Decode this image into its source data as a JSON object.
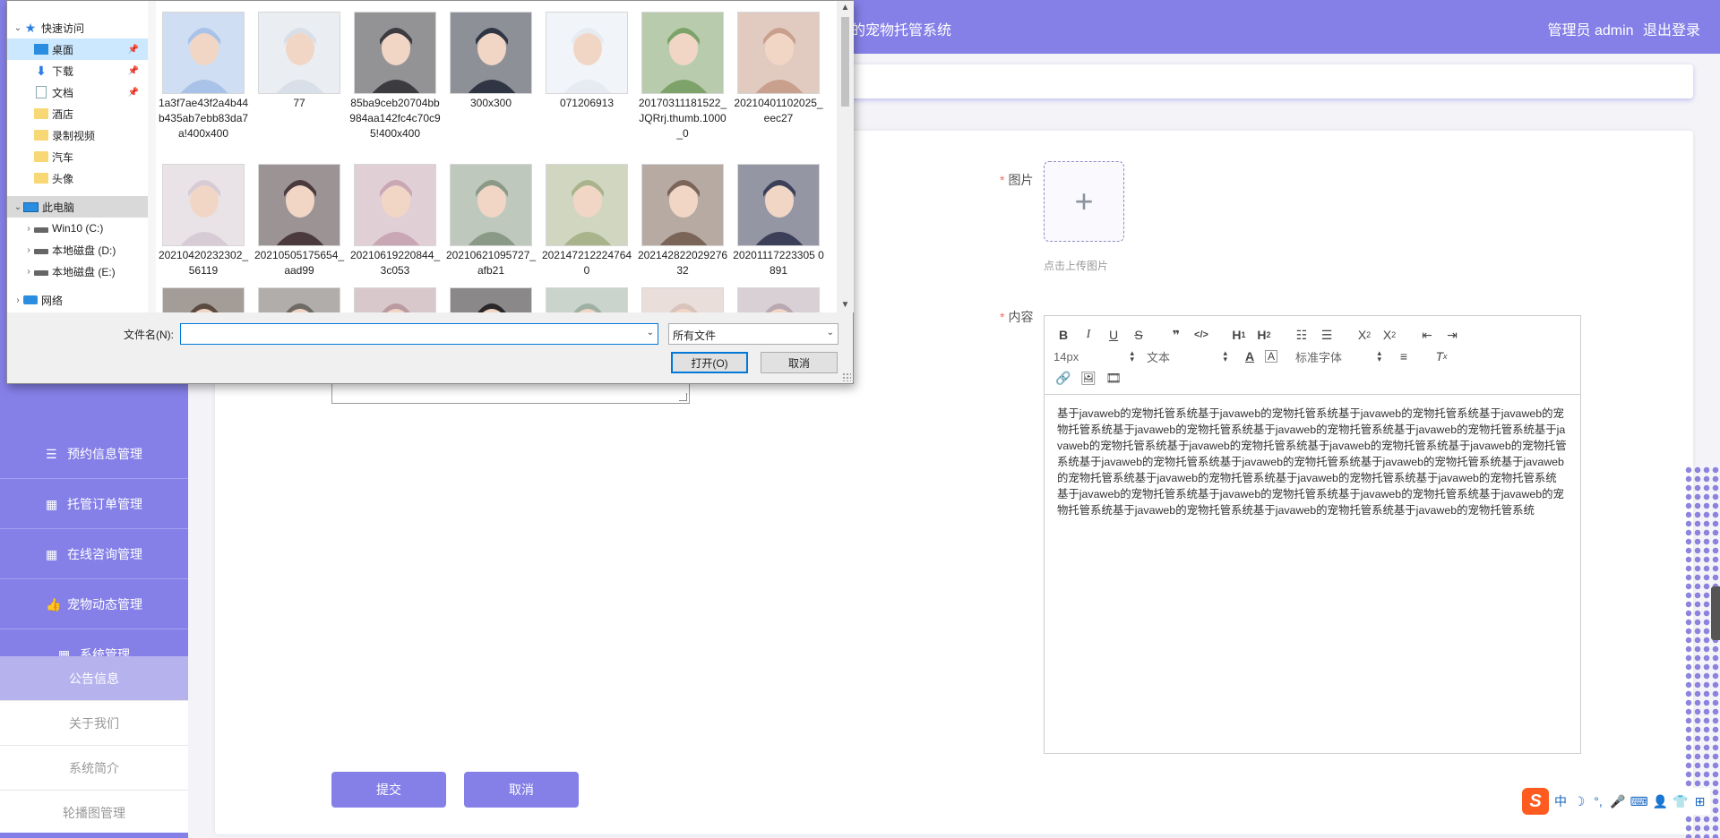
{
  "header": {
    "title_fragment": "的宠物托管系统",
    "user_text": "管理员 admin",
    "logout_label": "退出登录"
  },
  "sidebar": {
    "menu": [
      {
        "label": "预约信息管理",
        "icon": "list-icon"
      },
      {
        "label": "托管订单管理",
        "icon": "grid-icon"
      },
      {
        "label": "在线咨询管理",
        "icon": "grid-icon"
      },
      {
        "label": "宠物动态管理",
        "icon": "thumbs-up-icon"
      },
      {
        "label": "系统管理",
        "icon": "grid-icon"
      }
    ],
    "submenu": [
      {
        "label": "公告信息",
        "active": true
      },
      {
        "label": "关于我们",
        "active": false
      },
      {
        "label": "系统简介",
        "active": false
      },
      {
        "label": "轮播图管理",
        "active": false
      }
    ]
  },
  "form": {
    "image_label": "图片",
    "upload_tip": "点击上传图片",
    "content_label": "内容",
    "submit_label": "提交",
    "cancel_label": "取消"
  },
  "editor": {
    "font_size": "14px",
    "text_type": "文本",
    "font_family": "标准字体",
    "toolbar_row1": [
      "B",
      "I",
      "U",
      "S",
      "❞",
      "</>",
      "H1",
      "H2",
      "list-ordered",
      "list-bullet",
      "X₂",
      "X²",
      "outdent",
      "indent"
    ],
    "content": "基于javaweb的宠物托管系统基于javaweb的宠物托管系统基于javaweb的宠物托管系统基于javaweb的宠物托管系统基于javaweb的宠物托管系统基于javaweb的宠物托管系统基于javaweb的宠物托管系统基于javaweb的宠物托管系统基于javaweb的宠物托管系统基于javaweb的宠物托管系统基于javaweb的宠物托管系统基于javaweb的宠物托管系统基于javaweb的宠物托管系统基于javaweb的宠物托管系统基于javaweb的宠物托管系统基于javaweb的宠物托管系统基于javaweb的宠物托管系统基于javaweb的宠物托管系统基于javaweb的宠物托管系统基于javaweb的宠物托管系统基于javaweb的宠物托管系统基于javaweb的宠物托管系统基于javaweb的宠物托管系统基于javaweb的宠物托管系统基于javaweb的宠物托管系统"
  },
  "dialog": {
    "nav": [
      {
        "label": "快速访问",
        "icon": "star-icon",
        "chevron": "⌄",
        "indent": 0
      },
      {
        "label": "桌面",
        "icon": "desktop-icon",
        "pinned": true,
        "selected": true,
        "indent": 1
      },
      {
        "label": "下载",
        "icon": "download-icon",
        "pinned": true,
        "indent": 1
      },
      {
        "label": "文档",
        "icon": "document-icon",
        "pinned": true,
        "indent": 1
      },
      {
        "label": "酒店",
        "icon": "folder-icon",
        "indent": 1
      },
      {
        "label": "录制视频",
        "icon": "folder-icon",
        "indent": 1
      },
      {
        "label": "汽车",
        "icon": "folder-icon",
        "indent": 1
      },
      {
        "label": "头像",
        "icon": "folder-icon",
        "indent": 1
      },
      {
        "label": "此电脑",
        "icon": "computer-icon",
        "chevron": "⌄",
        "indent": 0,
        "group_selected": true
      },
      {
        "label": "Win10 (C:)",
        "icon": "drive-icon",
        "chevron": "›",
        "indent": 1
      },
      {
        "label": "本地磁盘 (D:)",
        "icon": "drive-icon",
        "chevron": "›",
        "indent": 1
      },
      {
        "label": "本地磁盘 (E:)",
        "icon": "drive-icon",
        "chevron": "›",
        "indent": 1
      },
      {
        "label": "网络",
        "icon": "network-icon",
        "chevron": "›",
        "indent": 0
      }
    ],
    "files": [
      {
        "name": "1a3f7ae43f2a4b44b435ab7ebb83da7a!400x400",
        "tone": "#a8c2e8"
      },
      {
        "name": "77",
        "tone": "#d9dfe8"
      },
      {
        "name": "85ba9ceb20704bb984aa142fc4c70c95!400x400",
        "tone": "#3b3b40"
      },
      {
        "name": "300x300",
        "tone": "#2f3542"
      },
      {
        "name": "071206913",
        "tone": "#e6ebf2"
      },
      {
        "name": "20170311181522_JQRrj.thumb.1000_0",
        "tone": "#7ea36a"
      },
      {
        "name": "20210401102025_eec27",
        "tone": "#c9a08d"
      },
      {
        "name": "20210420232302_56119",
        "tone": "#d7ccd6"
      },
      {
        "name": "20210505175654_aad99",
        "tone": "#4a3a3d"
      },
      {
        "name": "20210619220844_3c053",
        "tone": "#c9a7b4"
      },
      {
        "name": "20210621095727_afb21",
        "tone": "#8a9a86"
      },
      {
        "name": "2021472122247640",
        "tone": "#a9b48c"
      },
      {
        "name": "20214282202927632",
        "tone": "#7a6558"
      },
      {
        "name": "20201117223305 0891",
        "tone": "#3c3f58"
      },
      {
        "name": "",
        "tone": "#5a4a40"
      },
      {
        "name": "",
        "tone": "#6f6a66"
      },
      {
        "name": "",
        "tone": "#b89aa0"
      },
      {
        "name": "",
        "tone": "#2a2628"
      },
      {
        "name": "",
        "tone": "#9fb0a4"
      },
      {
        "name": "",
        "tone": "#d8c3bd"
      },
      {
        "name": "",
        "tone": "#b9a9b3"
      }
    ],
    "filename_label": "文件名(N):",
    "filename_value": "",
    "filter_value": "所有文件",
    "open_label": "打开(O)",
    "cancel_label": "取消"
  },
  "ime": {
    "logo": "S",
    "items": [
      "中",
      "☽",
      "°,",
      "🎤",
      "⌨",
      "👤",
      "👕",
      "⊞"
    ]
  },
  "colors": {
    "accent": "#8580e8",
    "submenu_active": "#b6b2ee",
    "required": "#f56c6c"
  }
}
